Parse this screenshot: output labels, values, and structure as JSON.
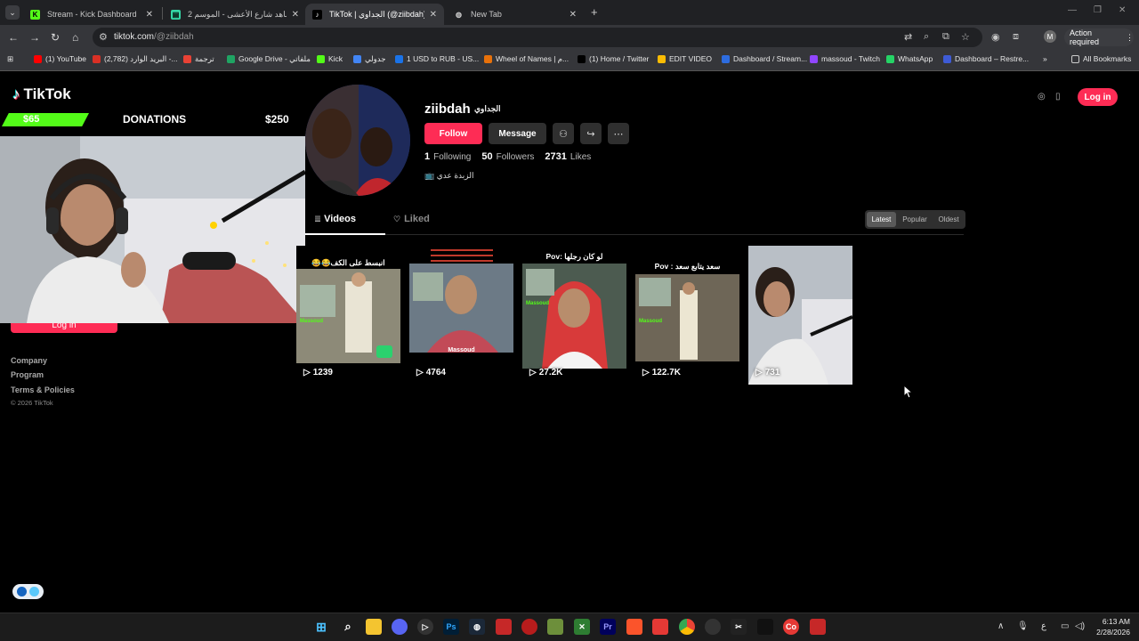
{
  "browser": {
    "tabs": [
      {
        "label": "Stream - Kick Dashboard",
        "active": false
      },
      {
        "label": "شاهد شارع الأعشى - الموسم 2 |",
        "active": false
      },
      {
        "label": "TikTok | الجداوي (@ziibdah)",
        "active": true
      },
      {
        "label": "New Tab",
        "active": false
      }
    ],
    "url_host": "tiktok.com",
    "url_path": "/@ziibdah",
    "profile_initial": "M",
    "action_required": "Action required",
    "bookmarks": [
      {
        "label": "(1) YouTube",
        "color": "#ff0000"
      },
      {
        "label": "(2,782) البريد الوارد -...",
        "color": "#d93025"
      },
      {
        "label": "ترجمة",
        "color": "#e94235"
      },
      {
        "label": "Google Drive - ملفاتي",
        "color": "#1fa463"
      },
      {
        "label": "Kick",
        "color": "#53fc18"
      },
      {
        "label": "جدولي",
        "color": "#4285f4"
      },
      {
        "label": "1 USD to RUB - US...",
        "color": "#1a73e8"
      },
      {
        "label": "Wheel of Names | م...",
        "color": "#e8710a"
      },
      {
        "label": "(1) Home / Twitter",
        "color": "#000000"
      },
      {
        "label": "EDIT VIDEO",
        "color": "#fbbc04"
      },
      {
        "label": "Dashboard / Stream...",
        "color": "#2d6cdf"
      },
      {
        "label": "massoud - Twitch",
        "color": "#9146ff"
      },
      {
        "label": "WhatsApp",
        "color": "#25d366"
      },
      {
        "label": "Dashboard – Restre...",
        "color": "#3e5bd6"
      }
    ],
    "all_bookmarks": "All Bookmarks"
  },
  "tiktok": {
    "logo": "TikTok",
    "header_login": "Log in",
    "sidebar": {
      "login_peek": "Log in",
      "links": [
        "Company",
        "Program",
        "Terms & Policies"
      ],
      "copyright": "© 2026 TikTok"
    },
    "profile": {
      "username": "ziibdah",
      "nickname": "الجداوي",
      "follow": "Follow",
      "message": "Message",
      "following_count": "1",
      "following_label": "Following",
      "followers_count": "50",
      "followers_label": "Followers",
      "likes_count": "2731",
      "likes_label": "Likes",
      "bio": "الزبدة عدي 📺"
    },
    "tabs": {
      "videos": "Videos",
      "liked": "Liked"
    },
    "sort": [
      "Latest",
      "Popular",
      "Oldest"
    ],
    "videos": [
      {
        "caption": "انبسط على الكف😂😂",
        "views": "1239",
        "overlay": "Massoud"
      },
      {
        "caption": "",
        "views": "4764",
        "overlay": "Massoud"
      },
      {
        "caption": "لو كان رجلها :Pov",
        "views": "27.2K",
        "overlay": "Massoud"
      },
      {
        "caption": "سعد يتابع سعد : Pov",
        "views": "122.7K",
        "overlay": "Massoud"
      },
      {
        "caption": "",
        "views": "731",
        "overlay": ""
      }
    ]
  },
  "overlay": {
    "donation_current": "$65",
    "donation_title": "DONATIONS",
    "donation_goal": "$250",
    "donation_progress": 0.26
  },
  "taskbar": {
    "time": "6:13 AM",
    "date": "2/28/2026",
    "lang": "ع"
  }
}
